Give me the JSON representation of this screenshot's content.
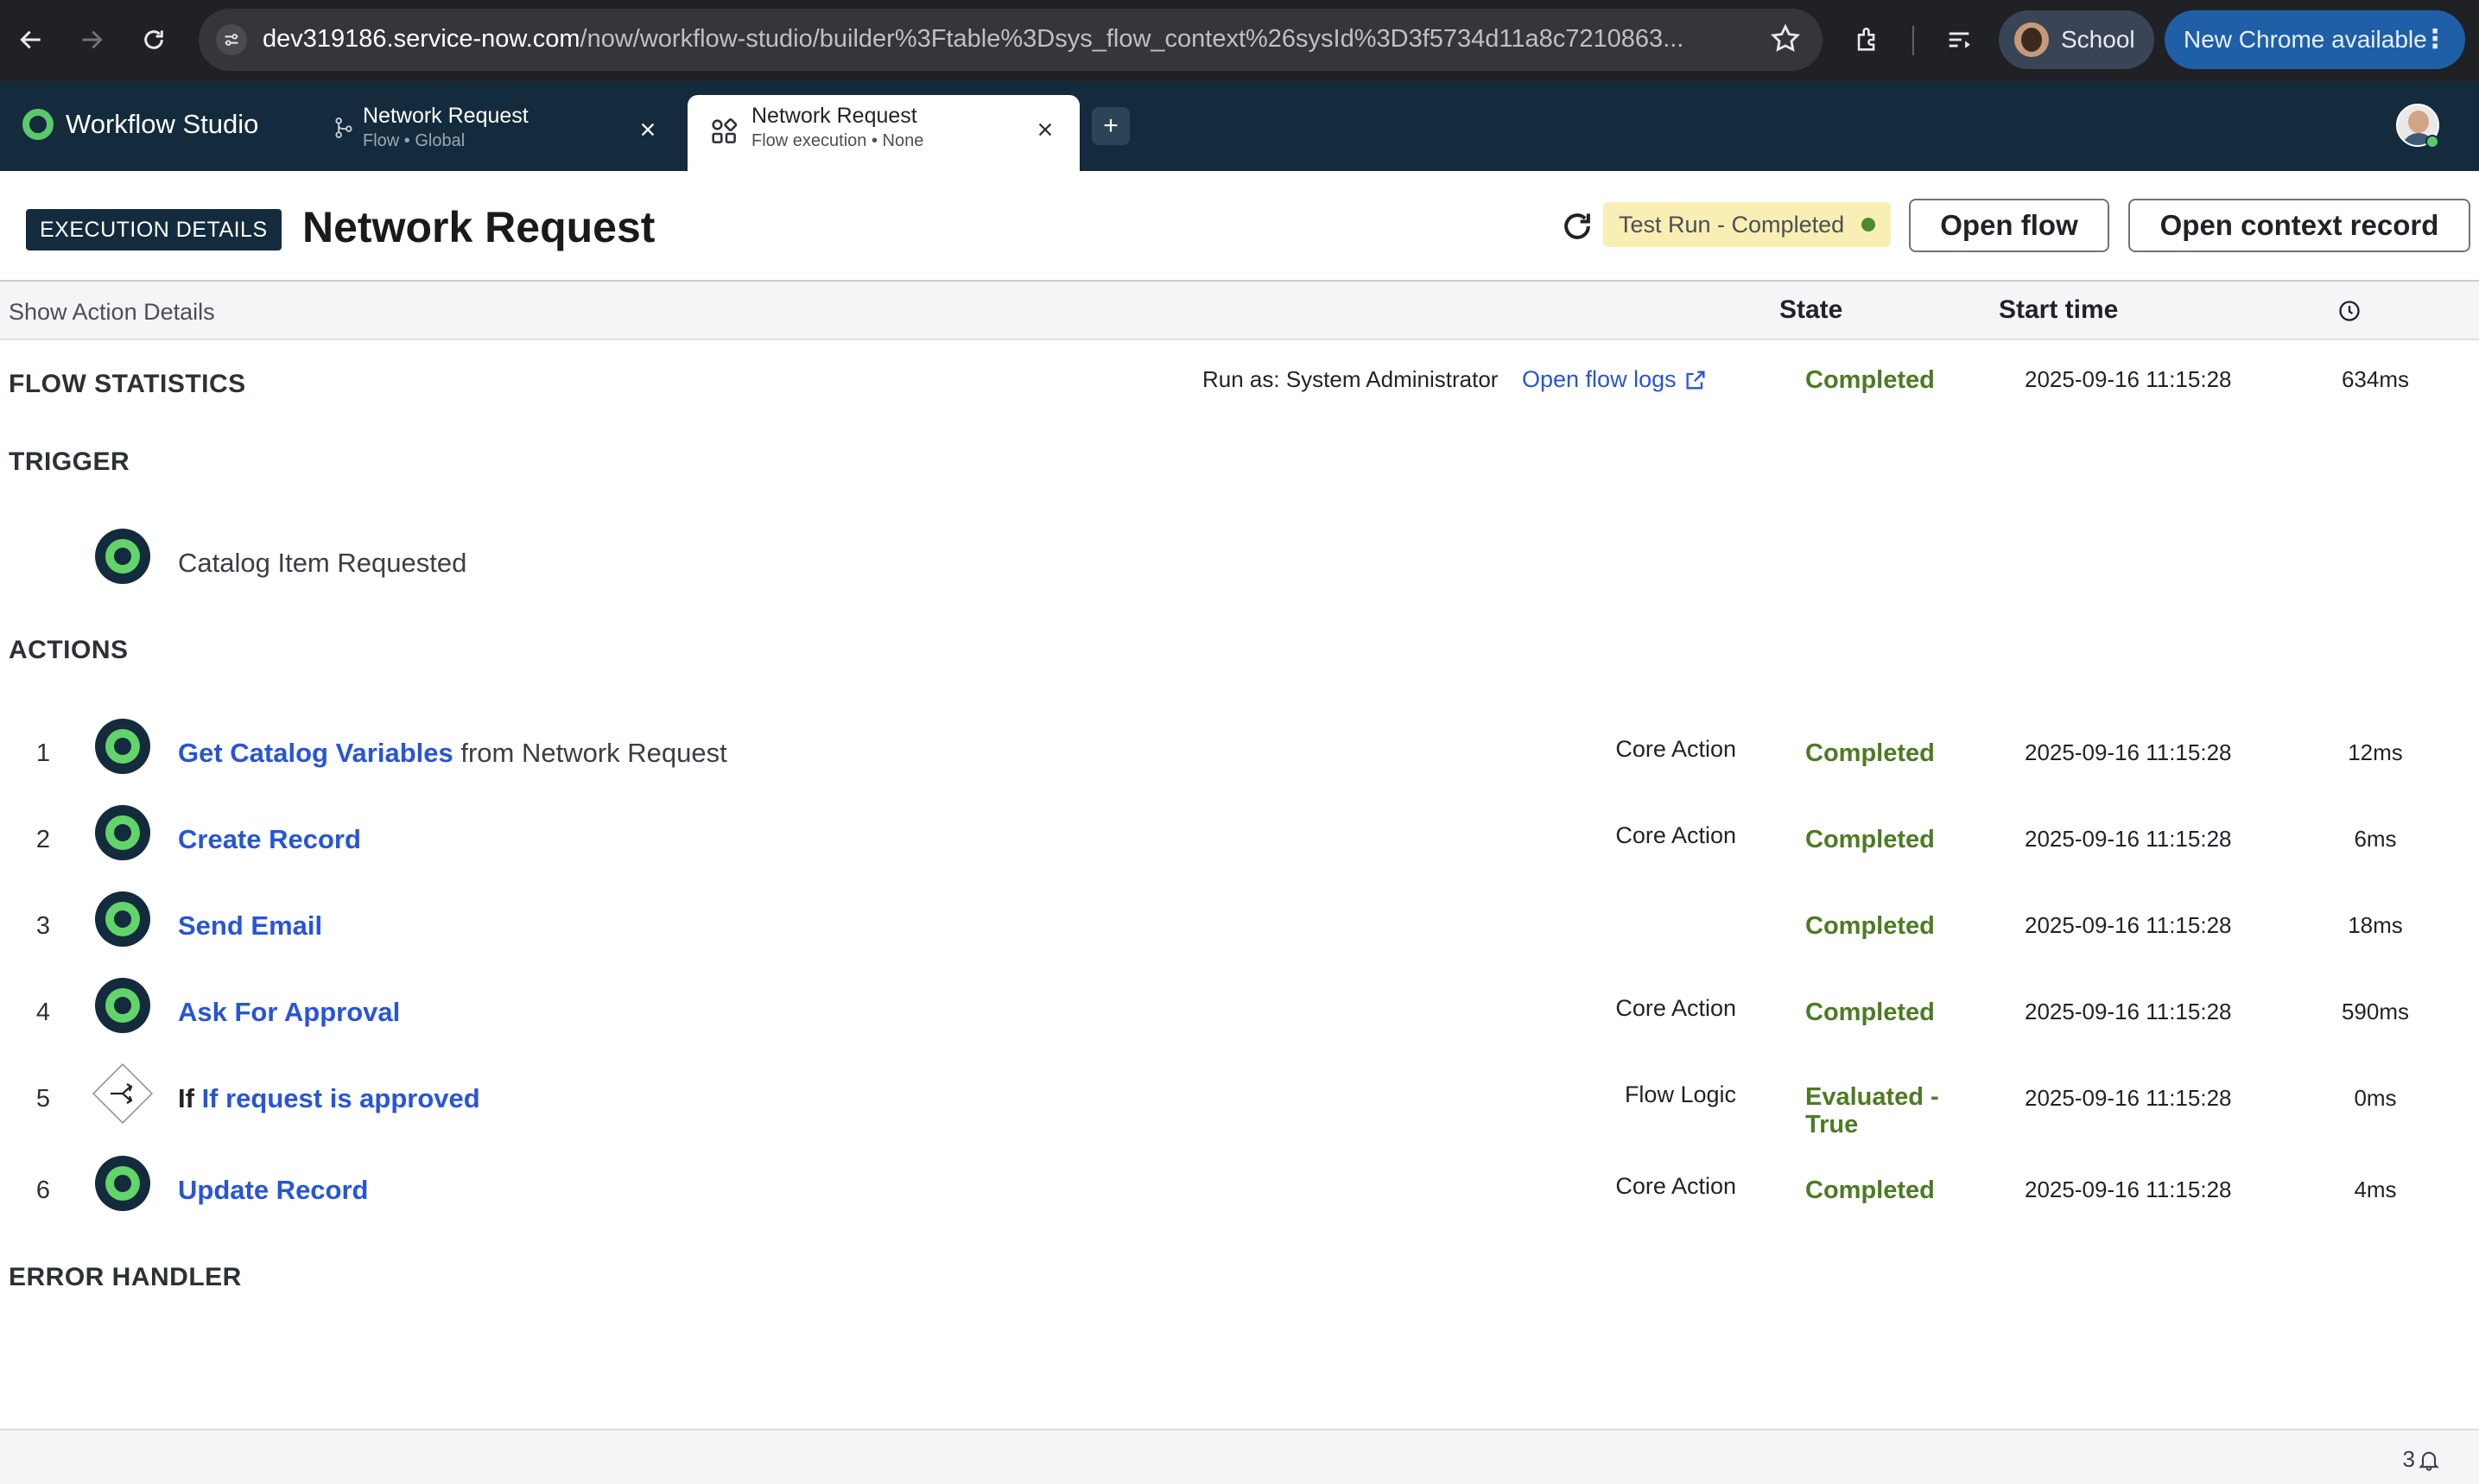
{
  "browser": {
    "url_host": "dev319186.service-now.com",
    "url_path": "/now/workflow-studio/builder%3Ftable%3Dsys_flow_context%26sysId%3D3f5734d11a8c7210863...",
    "profile_label": "School",
    "update_label": "New Chrome available"
  },
  "app": {
    "name": "Workflow Studio",
    "tabs": [
      {
        "title": "Network Request",
        "subtitle": "Flow • Global"
      },
      {
        "title": "Network Request",
        "subtitle": "Flow execution • None"
      }
    ],
    "new_tab_label": "+"
  },
  "header": {
    "badge": "EXECUTION DETAILS",
    "title": "Network Request",
    "status": "Test Run - Completed",
    "status_color": "#4d8a2c",
    "open_flow_label": "Open flow",
    "open_context_label": "Open context record"
  },
  "table": {
    "show_details_label": "Show Action Details",
    "state_header": "State",
    "start_header": "Start time"
  },
  "flow_stats": {
    "label": "FLOW STATISTICS",
    "run_as": "Run as: System Administrator",
    "logs_link": "Open flow logs",
    "state": "Completed",
    "start": "2025-09-16 11:15:28",
    "duration": "634ms"
  },
  "trigger": {
    "label": "TRIGGER",
    "name": "Catalog Item Requested"
  },
  "actions": {
    "label": "ACTIONS",
    "items": [
      {
        "num": "1",
        "name": "Get Catalog Variables",
        "suffix": "from Network Request",
        "type": "Core Action",
        "state": "Completed",
        "start": "2025-09-16 11:15:28",
        "duration": "12ms"
      },
      {
        "num": "2",
        "name": "Create Record",
        "type": "Core Action",
        "state": "Completed",
        "start": "2025-09-16 11:15:28",
        "duration": "6ms"
      },
      {
        "num": "3",
        "name": "Send Email",
        "type": "",
        "state": "Completed",
        "start": "2025-09-16 11:15:28",
        "duration": "18ms"
      },
      {
        "num": "4",
        "name": "Ask For Approval",
        "type": "Core Action",
        "state": "Completed",
        "start": "2025-09-16 11:15:28",
        "duration": "590ms"
      },
      {
        "num": "5",
        "prefix": "If",
        "name": "If request is approved",
        "type": "Flow Logic",
        "state_line1": "Evaluated -",
        "state_line2": "True",
        "start": "2025-09-16 11:15:28",
        "duration": "0ms"
      },
      {
        "num": "6",
        "name": "Update Record",
        "type": "Core Action",
        "state": "Completed",
        "start": "2025-09-16 11:15:28",
        "duration": "4ms"
      }
    ]
  },
  "error_handler": {
    "label": "ERROR HANDLER"
  },
  "footer": {
    "notification_count": "3"
  },
  "colors": {
    "appbar": "#132b3d",
    "completed": "#4c7b23",
    "link": "#2855d6",
    "status_badge_bg": "#f9eeb4"
  }
}
